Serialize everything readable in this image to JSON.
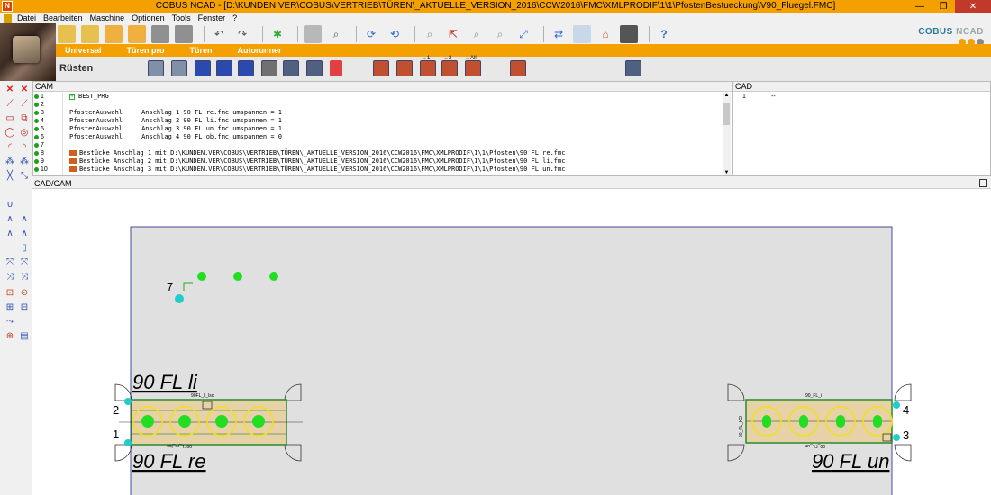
{
  "window": {
    "app_name": "COBUS NCAD",
    "title": "COBUS NCAD - [D:\\KUNDEN.VER\\COBUS\\VERTRIEB\\TÜREN\\_AKTUELLE_VERSION_2016\\CCW2016\\FMC\\XMLPRODIF\\1\\1\\PfostenBestueckung\\V90_Fluegel.FMC]",
    "minimize": "—",
    "maximize": "❐",
    "close": "✕"
  },
  "menu": [
    "Datei",
    "Bearbeiten",
    "Maschine",
    "Optionen",
    "Tools",
    "Fenster",
    "?"
  ],
  "brand": {
    "name_bold": "COBUS",
    "name_light": "NCAD"
  },
  "ribbon_tabs": [
    "Universal",
    "Türen pro",
    "Türen",
    "Autorunner"
  ],
  "subbar": {
    "label": "Rüsten",
    "icon_labels": [
      "→1",
      "→2",
      "→All"
    ]
  },
  "cam_panel": {
    "header": "CAM",
    "lines": [
      {
        "num": "1",
        "text": "BEST_PRG",
        "kind": "plus"
      },
      {
        "num": "2",
        "text": "",
        "kind": "none"
      },
      {
        "num": "3",
        "text": "PfostenAuswahl     Anschlag 1 90 FL re.fmc umspannen = 1",
        "kind": "none"
      },
      {
        "num": "4",
        "text": "PfostenAuswahl     Anschlag 2 90 FL li.fmc umspannen = 1",
        "kind": "none"
      },
      {
        "num": "5",
        "text": "PfostenAuswahl     Anschlag 3 90 FL un.fmc umspannen = 1",
        "kind": "none"
      },
      {
        "num": "6",
        "text": "PfostenAuswahl     Anschlag 4 90 FL ob.fmc umspannen = 0",
        "kind": "none"
      },
      {
        "num": "7",
        "text": "",
        "kind": "none"
      },
      {
        "num": "8",
        "text": "Bestücke Anschlag 1 mit D:\\KUNDEN.VER\\COBUS\\VERTRIEB\\TÜREN\\_AKTUELLE_VERSION_2016\\CCW2016\\FMC\\XMLPRODIF\\1\\1\\Pfosten\\90 FL re.fmc",
        "kind": "file"
      },
      {
        "num": "9",
        "text": "Bestücke Anschlag 2 mit D:\\KUNDEN.VER\\COBUS\\VERTRIEB\\TÜREN\\_AKTUELLE_VERSION_2016\\CCW2016\\FMC\\XMLPRODIF\\1\\1\\Pfosten\\90 FL li.fmc",
        "kind": "file"
      },
      {
        "num": "10",
        "text": "Bestücke Anschlag 3 mit D:\\KUNDEN.VER\\COBUS\\VERTRIEB\\TÜREN\\_AKTUELLE_VERSION_2016\\CCW2016\\FMC\\XMLPRODIF\\1\\1\\Pfosten\\90 FL un.fmc",
        "kind": "file"
      }
    ]
  },
  "cad_panel": {
    "header": "CAD",
    "row_num": "1",
    "row_text": "--"
  },
  "view": {
    "header": "CAD/CAM",
    "labels": {
      "fl_li": "90 FL li",
      "fl_re": "90 FL re",
      "fl_un": "90 FL un",
      "n1": "1",
      "n2": "2",
      "n3": "3",
      "n4": "4",
      "n7": "7",
      "small_li": "90FL_li_lso",
      "small_re": "90FL_re_lso",
      "small_i": "90_FL_i",
      "small_un": "90_FL_un",
      "small_ko": "90_FL_KO"
    }
  },
  "colors": {
    "accent_orange": "#f4a000",
    "drill_green": "#22dd22",
    "marker_cyan": "#22cccc",
    "ring_yellow": "#f0e020",
    "frame_green": "#2a8a2a",
    "part_fill": "#e6d2a6"
  }
}
